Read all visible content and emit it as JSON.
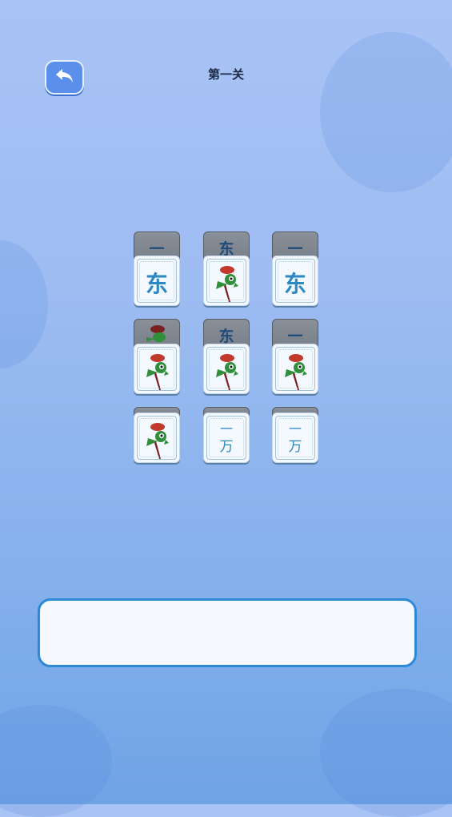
{
  "header": {
    "back_icon": "back-arrow-icon",
    "title": "第一关"
  },
  "tiles": [
    {
      "row": 0,
      "col": 0,
      "back_peek": "一",
      "face": "东"
    },
    {
      "row": 0,
      "col": 1,
      "back_peek": "东",
      "face": "bird"
    },
    {
      "row": 0,
      "col": 2,
      "back_peek": "一",
      "face": "东"
    },
    {
      "row": 1,
      "col": 0,
      "back_peek": "bird",
      "face": "bird"
    },
    {
      "row": 1,
      "col": 1,
      "back_peek": "东",
      "face": "bird"
    },
    {
      "row": 1,
      "col": 2,
      "back_peek": "一",
      "face": "bird"
    },
    {
      "row": 2,
      "col": 0,
      "back_peek": "",
      "face": "bird"
    },
    {
      "row": 2,
      "col": 1,
      "back_peek": "",
      "face_top": "一",
      "face_bottom": "万"
    },
    {
      "row": 2,
      "col": 2,
      "back_peek": "",
      "face_top": "一",
      "face_bottom": "万"
    }
  ],
  "tray": {
    "slots": []
  },
  "colors": {
    "accent": "#2d88d6",
    "tile_char": "#2b88c2",
    "back_button": "#5b8fec"
  }
}
